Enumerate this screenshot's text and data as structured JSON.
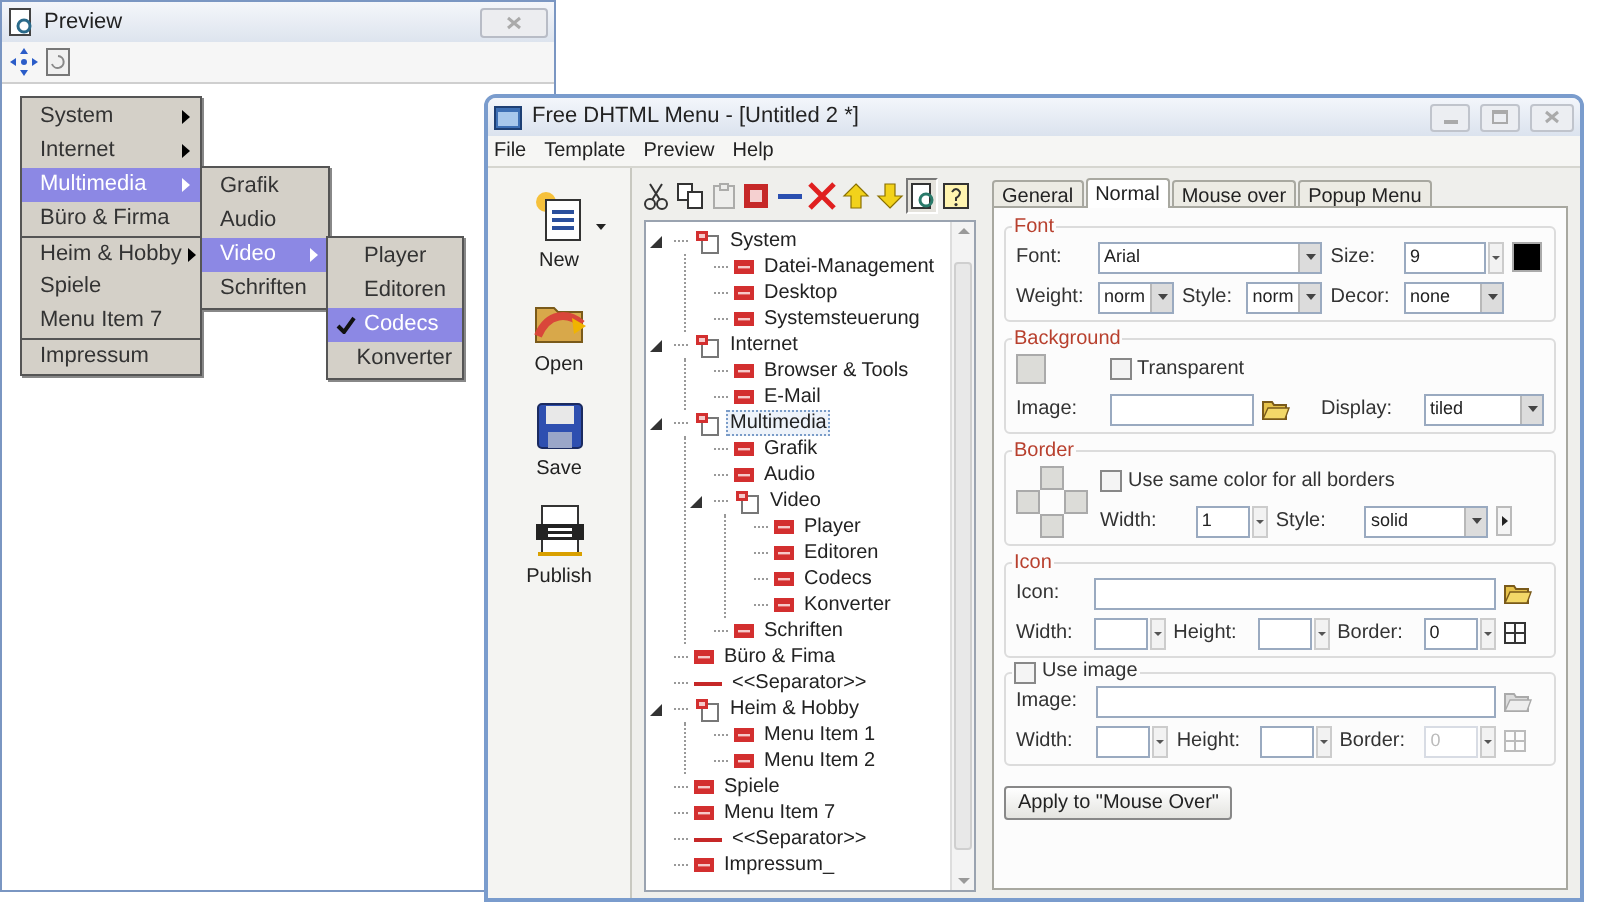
{
  "preview": {
    "title": "Preview",
    "menus": [
      {
        "items": [
          {
            "label": "System",
            "submenu": true,
            "selected": false,
            "checked": false,
            "separator_before": false
          },
          {
            "label": "Internet",
            "submenu": true,
            "selected": false,
            "checked": false,
            "separator_before": false
          },
          {
            "label": "Multimedia",
            "submenu": true,
            "selected": true,
            "checked": false,
            "separator_before": false
          },
          {
            "label": "Büro & Firma",
            "submenu": false,
            "selected": false,
            "checked": false,
            "separator_before": false
          },
          {
            "label": "Heim & Hobby",
            "submenu": true,
            "selected": false,
            "checked": false,
            "separator_before": true
          },
          {
            "label": "Spiele",
            "submenu": false,
            "selected": false,
            "checked": false,
            "separator_before": false
          },
          {
            "label": "Menu Item 7",
            "submenu": false,
            "selected": false,
            "checked": false,
            "separator_before": false
          },
          {
            "label": "Impressum",
            "submenu": false,
            "selected": false,
            "checked": false,
            "separator_before": true
          }
        ]
      },
      {
        "items": [
          {
            "label": "Grafik",
            "submenu": false,
            "selected": false,
            "checked": false,
            "separator_before": false
          },
          {
            "label": "Audio",
            "submenu": false,
            "selected": false,
            "checked": false,
            "separator_before": false
          },
          {
            "label": "Video",
            "submenu": true,
            "selected": true,
            "checked": false,
            "separator_before": false
          },
          {
            "label": "Schriften",
            "submenu": false,
            "selected": false,
            "checked": false,
            "separator_before": false
          }
        ]
      },
      {
        "items": [
          {
            "label": "Player",
            "submenu": false,
            "selected": false,
            "checked": false,
            "separator_before": false
          },
          {
            "label": "Editoren",
            "submenu": false,
            "selected": false,
            "checked": false,
            "separator_before": false
          },
          {
            "label": "Codecs",
            "submenu": false,
            "selected": true,
            "checked": true,
            "separator_before": false
          },
          {
            "label": "Konverter",
            "submenu": false,
            "selected": false,
            "checked": false,
            "separator_before": false
          }
        ]
      }
    ]
  },
  "window": {
    "title": "Free DHTML Menu - [Untitled 2 *]",
    "menu_bar": [
      "File",
      "Template",
      "Preview",
      "Help"
    ],
    "tools": [
      {
        "kind": "new",
        "label": "New",
        "dropdown": true
      },
      {
        "kind": "open",
        "label": "Open",
        "dropdown": false
      },
      {
        "kind": "save",
        "label": "Save",
        "dropdown": false
      },
      {
        "kind": "publish",
        "label": "Publish",
        "dropdown": false
      }
    ],
    "tree_toolbar": [
      {
        "kind": "cut",
        "disabled": false,
        "pressed": false
      },
      {
        "kind": "copy",
        "disabled": false,
        "pressed": false
      },
      {
        "kind": "paste",
        "disabled": true,
        "pressed": false
      },
      {
        "kind": "square",
        "disabled": false,
        "pressed": false
      },
      {
        "kind": "minus",
        "disabled": false,
        "pressed": false
      },
      {
        "kind": "delete",
        "disabled": false,
        "pressed": false
      },
      {
        "kind": "up",
        "disabled": false,
        "pressed": false
      },
      {
        "kind": "down",
        "disabled": false,
        "pressed": false
      },
      {
        "kind": "preview",
        "disabled": false,
        "pressed": true
      },
      {
        "kind": "help",
        "disabled": false,
        "pressed": false
      }
    ],
    "tree": [
      {
        "kind": "folder",
        "label": "System",
        "expanded": true,
        "selected": false,
        "children": [
          {
            "kind": "item",
            "label": "Datei-Management",
            "selected": false
          },
          {
            "kind": "item",
            "label": "Desktop",
            "selected": false
          },
          {
            "kind": "item",
            "label": "Systemsteuerung",
            "selected": false
          }
        ]
      },
      {
        "kind": "folder",
        "label": "Internet",
        "expanded": true,
        "selected": false,
        "children": [
          {
            "kind": "item",
            "label": "Browser & Tools",
            "selected": false
          },
          {
            "kind": "item",
            "label": "E-Mail",
            "selected": false
          }
        ]
      },
      {
        "kind": "folder",
        "label": "Multimedia",
        "expanded": true,
        "selected": true,
        "children": [
          {
            "kind": "item",
            "label": "Grafik",
            "selected": false
          },
          {
            "kind": "item",
            "label": "Audio",
            "selected": false
          },
          {
            "kind": "folder",
            "label": "Video",
            "expanded": true,
            "selected": false,
            "children": [
              {
                "kind": "item",
                "label": "Player",
                "selected": false
              },
              {
                "kind": "item",
                "label": "Editoren",
                "selected": false
              },
              {
                "kind": "item",
                "label": "Codecs",
                "selected": false
              },
              {
                "kind": "item",
                "label": "Konverter",
                "selected": false
              }
            ]
          },
          {
            "kind": "item",
            "label": "Schriften",
            "selected": false
          }
        ]
      },
      {
        "kind": "item",
        "label": "Büro & Fima",
        "selected": false
      },
      {
        "kind": "separator",
        "label": "<<Separator>>",
        "selected": false
      },
      {
        "kind": "folder",
        "label": "Heim & Hobby",
        "expanded": true,
        "selected": false,
        "children": [
          {
            "kind": "item",
            "label": "Menu Item 1",
            "selected": false
          },
          {
            "kind": "item",
            "label": "Menu Item 2",
            "selected": false
          }
        ]
      },
      {
        "kind": "item",
        "label": "Spiele",
        "selected": false
      },
      {
        "kind": "item",
        "label": "Menu Item 7",
        "selected": false
      },
      {
        "kind": "separator",
        "label": "<<Separator>>",
        "selected": false
      },
      {
        "kind": "item",
        "label": "Impressum_",
        "selected": false
      }
    ],
    "tabs": [
      {
        "label": "General",
        "selected": false
      },
      {
        "label": "Normal",
        "selected": true
      },
      {
        "label": "Mouse over",
        "selected": false
      },
      {
        "label": "Popup Menu",
        "selected": false
      }
    ],
    "sections": [
      {
        "kind": "form",
        "title": "Font",
        "fields": [
          {
            "kind": "label",
            "text": "Font:"
          },
          {
            "kind": "combo",
            "value": "Arial"
          },
          {
            "kind": "label",
            "text": "Size:"
          },
          {
            "kind": "spin",
            "value": "9",
            "disabled": false
          },
          {
            "kind": "color"
          },
          {
            "kind": "label",
            "text": "Weight:"
          },
          {
            "kind": "combo",
            "value": "norm"
          },
          {
            "kind": "label",
            "text": "Style:"
          },
          {
            "kind": "combo",
            "value": "norm"
          },
          {
            "kind": "label",
            "text": "Decor:"
          },
          {
            "kind": "combo",
            "value": "none"
          }
        ]
      },
      {
        "kind": "form",
        "title": "Background",
        "fields": [
          {
            "kind": "color"
          },
          {
            "kind": "checkbox",
            "text": "Transparent",
            "checked": false
          },
          {
            "kind": "label",
            "text": "Image:"
          },
          {
            "kind": "input"
          },
          {
            "kind": "folder",
            "disabled": false
          },
          {
            "kind": "label",
            "text": "Display:"
          },
          {
            "kind": "combo",
            "value": "tiled"
          }
        ]
      },
      {
        "kind": "border",
        "title": "Border",
        "fields": [
          {
            "kind": "checkbox",
            "text": "Use same color for all borders",
            "checked": false
          },
          {
            "kind": "label",
            "text": "Width:"
          },
          {
            "kind": "spin",
            "value": "1",
            "disabled": false
          },
          {
            "kind": "label",
            "text": "Style:"
          },
          {
            "kind": "combo",
            "value": "solid"
          },
          {
            "kind": "more"
          }
        ]
      },
      {
        "kind": "form",
        "title": "Icon",
        "fields": [
          {
            "kind": "label",
            "text": "Icon:"
          },
          {
            "kind": "input"
          },
          {
            "kind": "folder",
            "disabled": false
          },
          {
            "kind": "label",
            "text": "Width:"
          },
          {
            "kind": "spin",
            "disabled": false
          },
          {
            "kind": "label",
            "text": "Height:"
          },
          {
            "kind": "spin",
            "disabled": false
          },
          {
            "kind": "label",
            "text": "Border:"
          },
          {
            "kind": "spin",
            "value": "0",
            "disabled": false
          },
          {
            "kind": "grid",
            "disabled": false
          }
        ]
      },
      {
        "kind": "checkform",
        "title": "Use image",
        "checked": false,
        "fields": [
          {
            "kind": "label",
            "text": "Image:"
          },
          {
            "kind": "input"
          },
          {
            "kind": "folder",
            "disabled": true
          },
          {
            "kind": "label",
            "text": "Width:"
          },
          {
            "kind": "spin",
            "disabled": false
          },
          {
            "kind": "label",
            "text": "Height:"
          },
          {
            "kind": "spin",
            "disabled": false
          },
          {
            "kind": "label",
            "text": "Border:"
          },
          {
            "kind": "spin",
            "value": "0",
            "disabled": true
          },
          {
            "kind": "grid",
            "disabled": true
          }
        ]
      }
    ],
    "apply_button": "Apply to \"Mouse Over\""
  }
}
